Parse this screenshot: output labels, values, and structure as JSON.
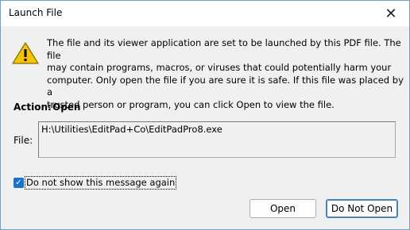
{
  "window": {
    "title": "Launch File"
  },
  "message": "The file and its viewer application are set to be launched by this PDF file. The file\nmay contain programs, macros, or viruses that could potentially harm your\ncomputer. Only open the file if you are sure it is safe. If this file was placed by a\ntrusted person or program, you can click Open to view the file.",
  "action": {
    "label": "Action:",
    "value": "Open"
  },
  "file": {
    "label": "File:",
    "path": "H:\\Utilities\\EditPad+Co\\EditPadPro8.exe"
  },
  "checkbox": {
    "label": "Do not show this message again",
    "checked": true
  },
  "buttons": {
    "open": "Open",
    "do_not_open": "Do Not Open"
  },
  "icons": {
    "close": "close-icon",
    "warning": "warning-icon",
    "check": "check-icon"
  },
  "colors": {
    "accent": "#1a73c9",
    "warning": "#f0c000"
  }
}
